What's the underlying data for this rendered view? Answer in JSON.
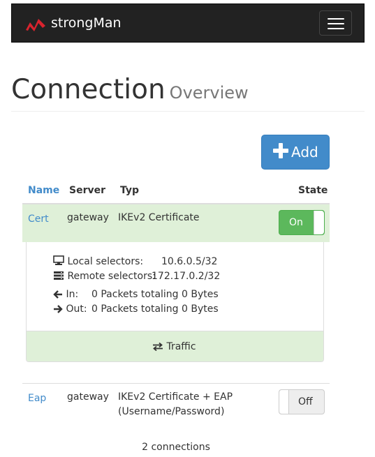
{
  "navbar": {
    "brand": "strongMan",
    "logo_icon": "strongman-logo-icon",
    "menu_icon": "hamburger-menu-icon",
    "bg_color": "#222222",
    "logo_color": "#d9232e"
  },
  "header": {
    "title": "Connection",
    "subtitle": "Overview"
  },
  "toolbar": {
    "add_label": "Add",
    "add_icon": "plus-icon",
    "accent": "#428bca"
  },
  "table": {
    "columns": {
      "name": "Name",
      "server": "Server",
      "type": "Typ",
      "state": "State"
    },
    "rows": [
      {
        "name": "Cert",
        "server": "gateway",
        "type": "IKEv2 Certificate",
        "state": "On",
        "expanded": true,
        "details": {
          "local_label": "Local selectors:",
          "local_value": "10.6.0.5/32",
          "remote_label": "Remote selectors:",
          "remote_value": "172.17.0.2/32",
          "in_label": "In:",
          "in_value": "0 Packets totaling 0 Bytes",
          "out_label": "Out:",
          "out_value": "0 Packets totaling 0 Bytes",
          "traffic_label": "Traffic"
        }
      },
      {
        "name": "Eap",
        "server": "gateway",
        "type_line1": "IKEv2 Certificate + EAP",
        "type_line2": "(Username/Password)",
        "state": "Off",
        "expanded": false
      }
    ]
  },
  "footer": {
    "count": "2 connections"
  },
  "colors": {
    "success_bg": "#dff0d8",
    "toggle_on": "#5cb85c",
    "toggle_off": "#eeeeee"
  }
}
